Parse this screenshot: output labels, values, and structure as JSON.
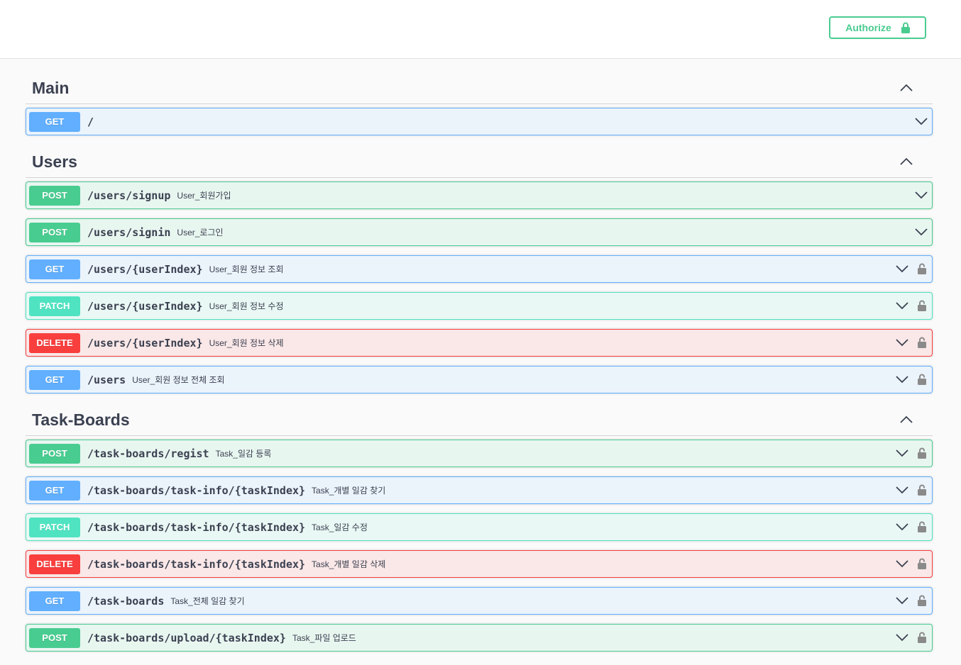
{
  "header": {
    "authorize_label": "Authorize"
  },
  "colors": {
    "get": "#61affe",
    "post": "#49cc90",
    "patch": "#50e3c2",
    "delete": "#f93e3e"
  },
  "sections": [
    {
      "title": "Main",
      "operations": [
        {
          "method": "GET",
          "path": "/",
          "summary": "",
          "locked": false
        }
      ]
    },
    {
      "title": "Users",
      "operations": [
        {
          "method": "POST",
          "path": "/users/signup",
          "summary": "User_회원가입",
          "locked": false
        },
        {
          "method": "POST",
          "path": "/users/signin",
          "summary": "User_로그인",
          "locked": false
        },
        {
          "method": "GET",
          "path": "/users/{userIndex}",
          "summary": "User_회원 정보 조회",
          "locked": true
        },
        {
          "method": "PATCH",
          "path": "/users/{userIndex}",
          "summary": "User_회원 정보 수정",
          "locked": true
        },
        {
          "method": "DELETE",
          "path": "/users/{userIndex}",
          "summary": "User_회원 정보 삭제",
          "locked": true
        },
        {
          "method": "GET",
          "path": "/users",
          "summary": "User_회원 정보 전체 조회",
          "locked": true
        }
      ]
    },
    {
      "title": "Task-Boards",
      "operations": [
        {
          "method": "POST",
          "path": "/task-boards/regist",
          "summary": "Task_일감 등록",
          "locked": true
        },
        {
          "method": "GET",
          "path": "/task-boards/task-info/{taskIndex}",
          "summary": "Task_개별 일감 찾기",
          "locked": true
        },
        {
          "method": "PATCH",
          "path": "/task-boards/task-info/{taskIndex}",
          "summary": "Task_일감 수정",
          "locked": true
        },
        {
          "method": "DELETE",
          "path": "/task-boards/task-info/{taskIndex}",
          "summary": "Task_개별 일감 삭제",
          "locked": true
        },
        {
          "method": "GET",
          "path": "/task-boards",
          "summary": "Task_전체 일감 찾기",
          "locked": true
        },
        {
          "method": "POST",
          "path": "/task-boards/upload/{taskIndex}",
          "summary": "Task_파일 업로드",
          "locked": true
        }
      ]
    }
  ]
}
